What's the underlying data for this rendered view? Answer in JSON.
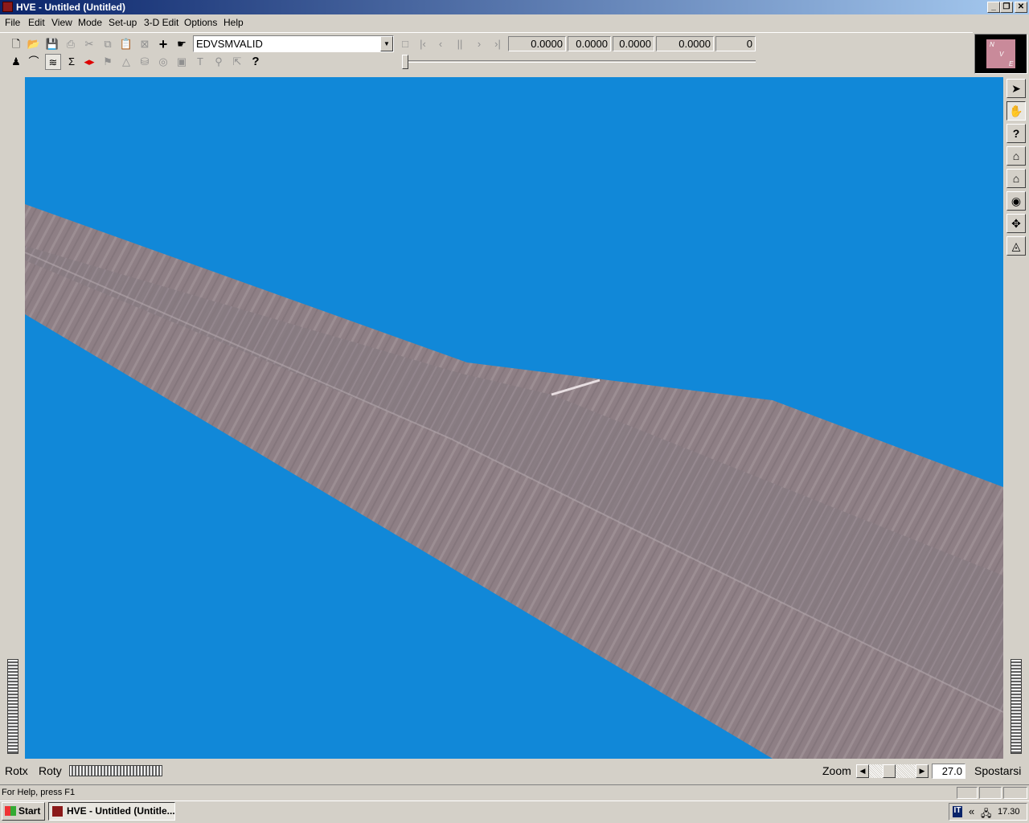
{
  "window": {
    "title": "HVE - Untitled (Untitled)"
  },
  "menu": [
    "File",
    "Edit",
    "View",
    "Mode",
    "Set-up",
    "3-D Edit",
    "Options",
    "Help"
  ],
  "toolbar": {
    "event_combo": "EDVSMVALID",
    "readouts": [
      "0.0000",
      "0.0000",
      "0.0000",
      "0.0000",
      "0"
    ]
  },
  "logo": {
    "letters": [
      "N",
      "V",
      "E"
    ]
  },
  "bottom": {
    "rotx_label": "Rotx",
    "roty_label": "Roty",
    "zoom_label": "Zoom",
    "zoom_value": "27.0",
    "mode_label": "Spostarsi"
  },
  "status": {
    "help_text": "For Help, press F1"
  },
  "taskbar": {
    "start_label": "Start",
    "task_label": "HVE - Untitled (Untitle...",
    "tray_lang": "IT",
    "tray_arrows": "«",
    "clock": "17.30"
  },
  "colors": {
    "viewport_sky": "#1188d8",
    "road": "#8e7f85"
  }
}
